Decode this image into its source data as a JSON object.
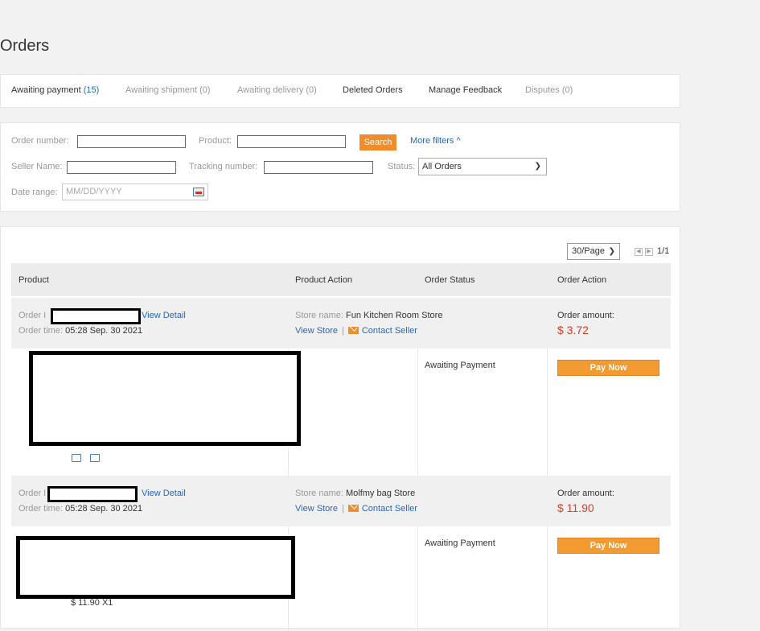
{
  "page_title": "Orders",
  "tabs": [
    {
      "label": "Awaiting payment",
      "count": "(15)"
    },
    {
      "label": "Awaiting shipment (0)"
    },
    {
      "label": "Awaiting delivery (0)"
    },
    {
      "label": "Deleted Orders"
    },
    {
      "label": "Manage Feedback"
    },
    {
      "label": "Disputes (0)"
    }
  ],
  "filters": {
    "order_number_label": "Order number:",
    "product_label": "Product:",
    "search_button": "Search",
    "more_filters": "More filters ^",
    "seller_name_label": "Seller Name:",
    "tracking_label": "Tracking number:",
    "status_label": "Status:",
    "status_value": "All Orders",
    "date_label": "Date range:",
    "date_placeholder": "MM/DD/YYYY"
  },
  "pagination": {
    "per_page": "30/Page",
    "pages": "1/1"
  },
  "table_headers": {
    "product": "Product",
    "product_action": "Product Action",
    "order_status": "Order Status",
    "order_action": "Order Action"
  },
  "orders": [
    {
      "order_label": "Order I",
      "view_detail": "View Detail",
      "order_time_label": "Order time:",
      "order_time": "05:28 Sep. 30 2021",
      "store_label": "Store name:",
      "store_name": "Fun Kitchen Room Store",
      "view_store": "View Store",
      "contact_seller": "Contact Seller",
      "amount_label": "Order amount:",
      "amount": "$ 3.72",
      "status": "Awaiting Payment",
      "action": "Pay Now"
    },
    {
      "order_label": "Order I",
      "view_detail": "View Detail",
      "order_time_label": "Order time:",
      "order_time": "05:28 Sep. 30 2021",
      "store_label": "Store name:",
      "store_name": "Molfmy bag Store",
      "view_store": "View Store",
      "contact_seller": "Contact Seller",
      "amount_label": "Order amount:",
      "amount": "$ 11.90",
      "status": "Awaiting Payment",
      "action": "Pay Now",
      "price_qty": "$ 11.90 X1"
    }
  ],
  "icons": [
    "truck-icon",
    "card-icon",
    "mail-icon",
    "calendar-icon",
    "chevron-down-icon",
    "prev-page-icon",
    "next-page-icon"
  ],
  "colors": {
    "accent": "#f08c2a",
    "link": "#2a66b8",
    "price": "#d9402a"
  }
}
